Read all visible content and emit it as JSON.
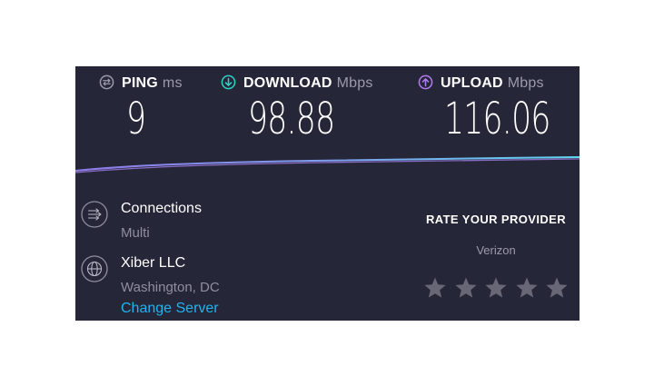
{
  "ping": {
    "label": "PING",
    "unit": "ms",
    "value": "9",
    "icon": "ping-icon",
    "color": "#9a9aac"
  },
  "download": {
    "label": "DOWNLOAD",
    "unit": "Mbps",
    "value": "98.88",
    "icon": "download-arrow-icon",
    "color": "#2dd4c3"
  },
  "upload": {
    "label": "UPLOAD",
    "unit": "Mbps",
    "value": "116.06",
    "icon": "upload-arrow-icon",
    "color": "#b27cf0"
  },
  "connections": {
    "title": "Connections",
    "value": "Multi",
    "icon": "connections-icon"
  },
  "server": {
    "name": "Xiber LLC",
    "location": "Washington, DC",
    "change_label": "Change Server",
    "icon": "globe-icon"
  },
  "rating": {
    "title": "RATE YOUR PROVIDER",
    "provider": "Verizon",
    "star_count": 5,
    "selected": 0
  },
  "colors": {
    "background": "#262639",
    "accent_link": "#1fb4f0",
    "star": "#676777"
  }
}
